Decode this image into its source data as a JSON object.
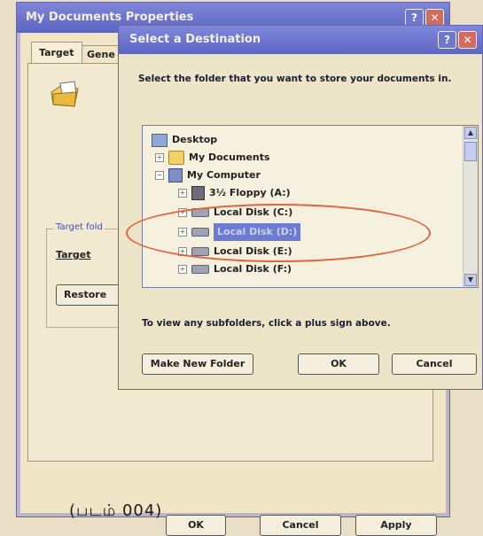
{
  "properties_window": {
    "title": "My Documents Properties",
    "tabs": [
      "Target",
      "Gene"
    ],
    "group_label": "Target fold",
    "target_label": "Target",
    "restore_button": "Restore",
    "buttons": {
      "ok": "OK",
      "cancel": "Cancel",
      "apply": "Apply"
    }
  },
  "caption": "(படம் 004)",
  "dialog": {
    "title": "Select a Destination",
    "prompt": "Select the folder that you want to store your documents in.",
    "tree": [
      {
        "label": "Desktop",
        "icon": "desktop-icon"
      },
      {
        "label": "My Documents",
        "icon": "my-documents-icon"
      },
      {
        "label": "My Computer",
        "icon": "my-computer-icon"
      },
      {
        "label": "3½ Floppy (A:)",
        "icon": "floppy-drive-icon"
      },
      {
        "label": "Local Disk (C:)",
        "icon": "disk-drive-icon"
      },
      {
        "label": "Local Disk (D:)",
        "icon": "disk-drive-icon",
        "selected": true
      },
      {
        "label": "Local Disk (E:)",
        "icon": "disk-drive-icon"
      },
      {
        "label": "Local Disk (F:)",
        "icon": "disk-drive-icon"
      }
    ],
    "hint": "To view any subfolders, click a plus sign above.",
    "buttons": {
      "make_new_folder": "Make New Folder",
      "ok": "OK",
      "cancel": "Cancel"
    }
  },
  "colors": {
    "title_bar": "#6b74cc",
    "highlight_ring": "#e2633f",
    "selection": "#6b7cd1"
  }
}
